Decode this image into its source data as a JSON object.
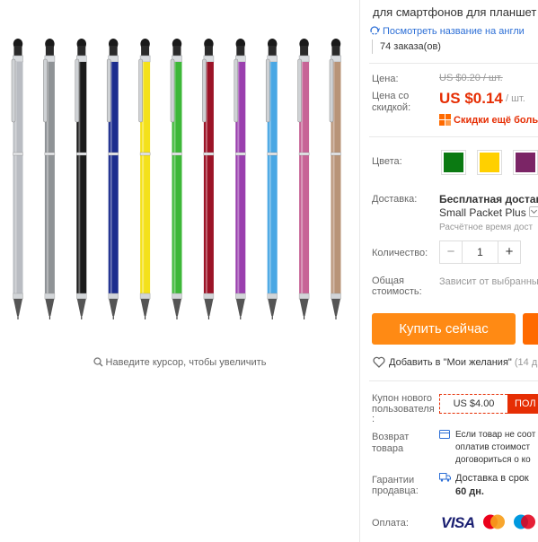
{
  "gallery": {
    "zoom_hint": "Наведите курсор, чтобы увеличить",
    "pen_colors": [
      "#b9bcc2",
      "#8f9396",
      "#1b1b1b",
      "#1c2d8e",
      "#f4e11b",
      "#3db738",
      "#9b1327",
      "#9a3fae",
      "#49a7e4",
      "#c76496",
      "#b89478"
    ]
  },
  "product": {
    "title": "для смартфонов для планшет",
    "translate_link": "Посмотреть название на англи",
    "orders": "74 заказа(ов)"
  },
  "price": {
    "label": "Цена:",
    "old_value": "US $0.20 / шт.",
    "discount_label_line1": "Цена со",
    "discount_label_line2": "скидкой:",
    "new_value": "US $0.14",
    "unit": "/ шт.",
    "more_discounts": "Скидки ещё больш"
  },
  "colors": {
    "label": "Цвета:",
    "swatches": [
      "#0b7a12",
      "#ffd000",
      "#7b2566"
    ]
  },
  "shipping": {
    "label": "Доставка:",
    "title": "Бесплатная доставка",
    "method": "Small Packet Plus",
    "estimate": "Расчётное время дост"
  },
  "quantity": {
    "label": "Количество:",
    "value": "1",
    "minus": "−",
    "plus": "+"
  },
  "total": {
    "label_line1": "Общая",
    "label_line2": "стоимость:",
    "value": "Зависит от выбранны"
  },
  "buttons": {
    "buy_now": "Купить сейчас"
  },
  "wishlist": {
    "label": "Добавить в \"Мои желания\"",
    "count": "(14 д"
  },
  "coupon": {
    "label_line1": "Купон нового",
    "label_line2": "пользователя",
    "label_line3": ":",
    "value": "US $4.00",
    "action": "ПОЛ"
  },
  "returns": {
    "label_line1": "Возврат",
    "label_line2": "товара",
    "line1": "Если товар не соот",
    "line2": "оплатив стоимост",
    "line3": "договориться о ко"
  },
  "guarantee": {
    "label_line1": "Гарантии",
    "label_line2": "продавца:",
    "text": "Доставка в срок",
    "days": "60 дн."
  },
  "payment": {
    "label": "Оплата:",
    "visa": "VISA"
  }
}
